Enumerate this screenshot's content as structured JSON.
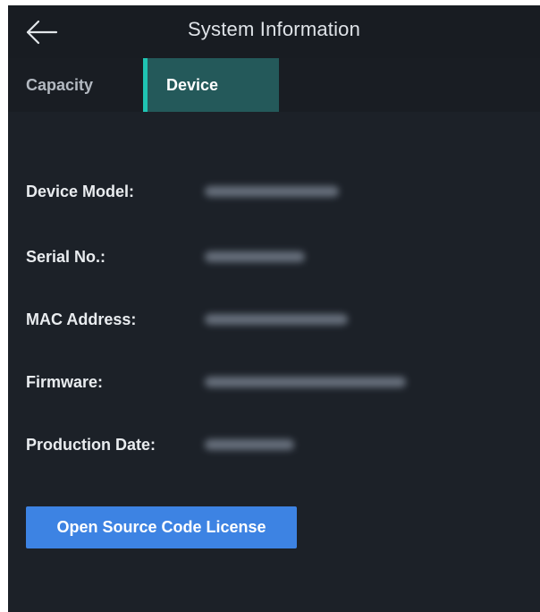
{
  "header": {
    "title": "System Information",
    "back_icon": "arrow-left-icon"
  },
  "tabs": [
    {
      "label": "Capacity",
      "active": false
    },
    {
      "label": "Device",
      "active": true
    }
  ],
  "device_info": {
    "fields": [
      {
        "label": "Device Model:",
        "value_state": "blurred"
      },
      {
        "label": "Serial No.:",
        "value_state": "blurred"
      },
      {
        "label": "MAC Address:",
        "value_state": "blurred"
      },
      {
        "label": "Firmware:",
        "value_state": "blurred"
      },
      {
        "label": "Production Date:",
        "value_state": "blurred"
      }
    ]
  },
  "actions": {
    "license_label": "Open Source Code License"
  },
  "colors": {
    "background": "#1c2128",
    "active_tab": "#24595a",
    "tab_indicator": "#1fc4b3",
    "button": "#3d83e3"
  }
}
